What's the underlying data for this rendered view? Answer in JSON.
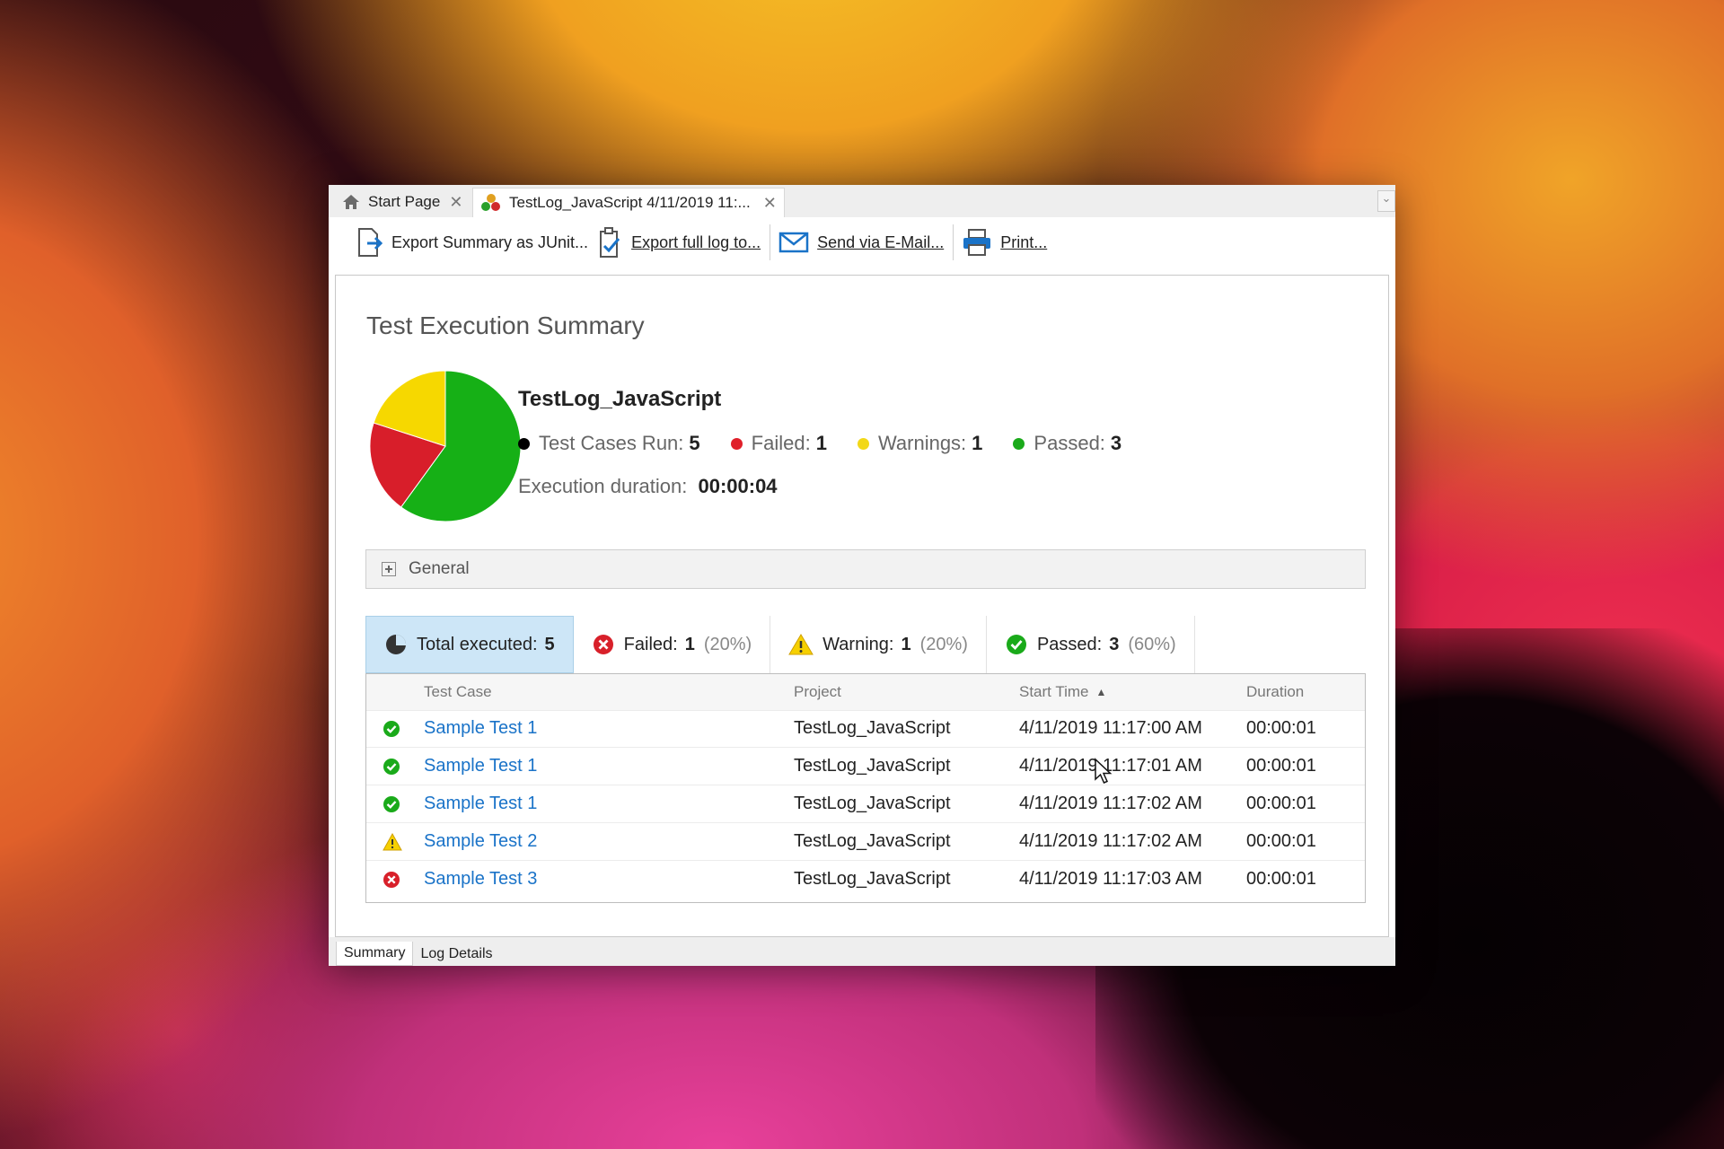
{
  "tabs": [
    {
      "label": "Start Page",
      "icon": "home-icon",
      "active": false
    },
    {
      "label": "TestLog_JavaScript 4/11/2019 11:...",
      "icon": "testlog-icon",
      "active": true
    }
  ],
  "toolbar": {
    "export_junit": "Export Summary as JUnit...",
    "export_full": "Export full log to...",
    "send_email": "Send via E-Mail...",
    "print": "Print..."
  },
  "summary": {
    "title": "Test Execution Summary",
    "log_name": "TestLog_JavaScript",
    "stats": [
      {
        "label": "Test Cases Run:",
        "value": "5",
        "color": "#000000"
      },
      {
        "label": "Failed:",
        "value": "1",
        "color": "#e0202a"
      },
      {
        "label": "Warnings:",
        "value": "1",
        "color": "#f2d818"
      },
      {
        "label": "Passed:",
        "value": "3",
        "color": "#1aaa1a"
      }
    ],
    "duration_label": "Execution duration:",
    "duration_value": "00:00:04",
    "pie": [
      {
        "name": "Passed",
        "value": 3,
        "color": "#16b016"
      },
      {
        "name": "Failed",
        "value": 1,
        "color": "#d81e2a"
      },
      {
        "name": "Warnings",
        "value": 1,
        "color": "#f6d800"
      }
    ]
  },
  "general": {
    "label": "General"
  },
  "filters": [
    {
      "label": "Total executed:",
      "count": "5",
      "pct": "",
      "icon": "pie-icon"
    },
    {
      "label": "Failed:",
      "count": "1",
      "pct": "(20%)",
      "icon": "error-icon"
    },
    {
      "label": "Warning:",
      "count": "1",
      "pct": "(20%)",
      "icon": "warning-icon"
    },
    {
      "label": "Passed:",
      "count": "3",
      "pct": "(60%)",
      "icon": "check-icon"
    }
  ],
  "grid": {
    "headers": {
      "test_case": "Test Case",
      "project": "Project",
      "start_time": "Start Time",
      "duration": "Duration"
    },
    "rows": [
      {
        "status": "passed",
        "name": "Sample Test 1",
        "project": "TestLog_JavaScript",
        "start": "4/11/2019 11:17:00 AM",
        "duration": "00:00:01"
      },
      {
        "status": "passed",
        "name": "Sample Test 1",
        "project": "TestLog_JavaScript",
        "start": "4/11/2019 11:17:01 AM",
        "duration": "00:00:01"
      },
      {
        "status": "passed",
        "name": "Sample Test 1",
        "project": "TestLog_JavaScript",
        "start": "4/11/2019 11:17:02 AM",
        "duration": "00:00:01"
      },
      {
        "status": "warning",
        "name": "Sample Test 2",
        "project": "TestLog_JavaScript",
        "start": "4/11/2019 11:17:02 AM",
        "duration": "00:00:01"
      },
      {
        "status": "failed",
        "name": "Sample Test 3",
        "project": "TestLog_JavaScript",
        "start": "4/11/2019 11:17:03 AM",
        "duration": "00:00:01"
      }
    ]
  },
  "bottom_tabs": [
    {
      "label": "Summary",
      "active": true
    },
    {
      "label": "Log Details",
      "active": false
    }
  ]
}
